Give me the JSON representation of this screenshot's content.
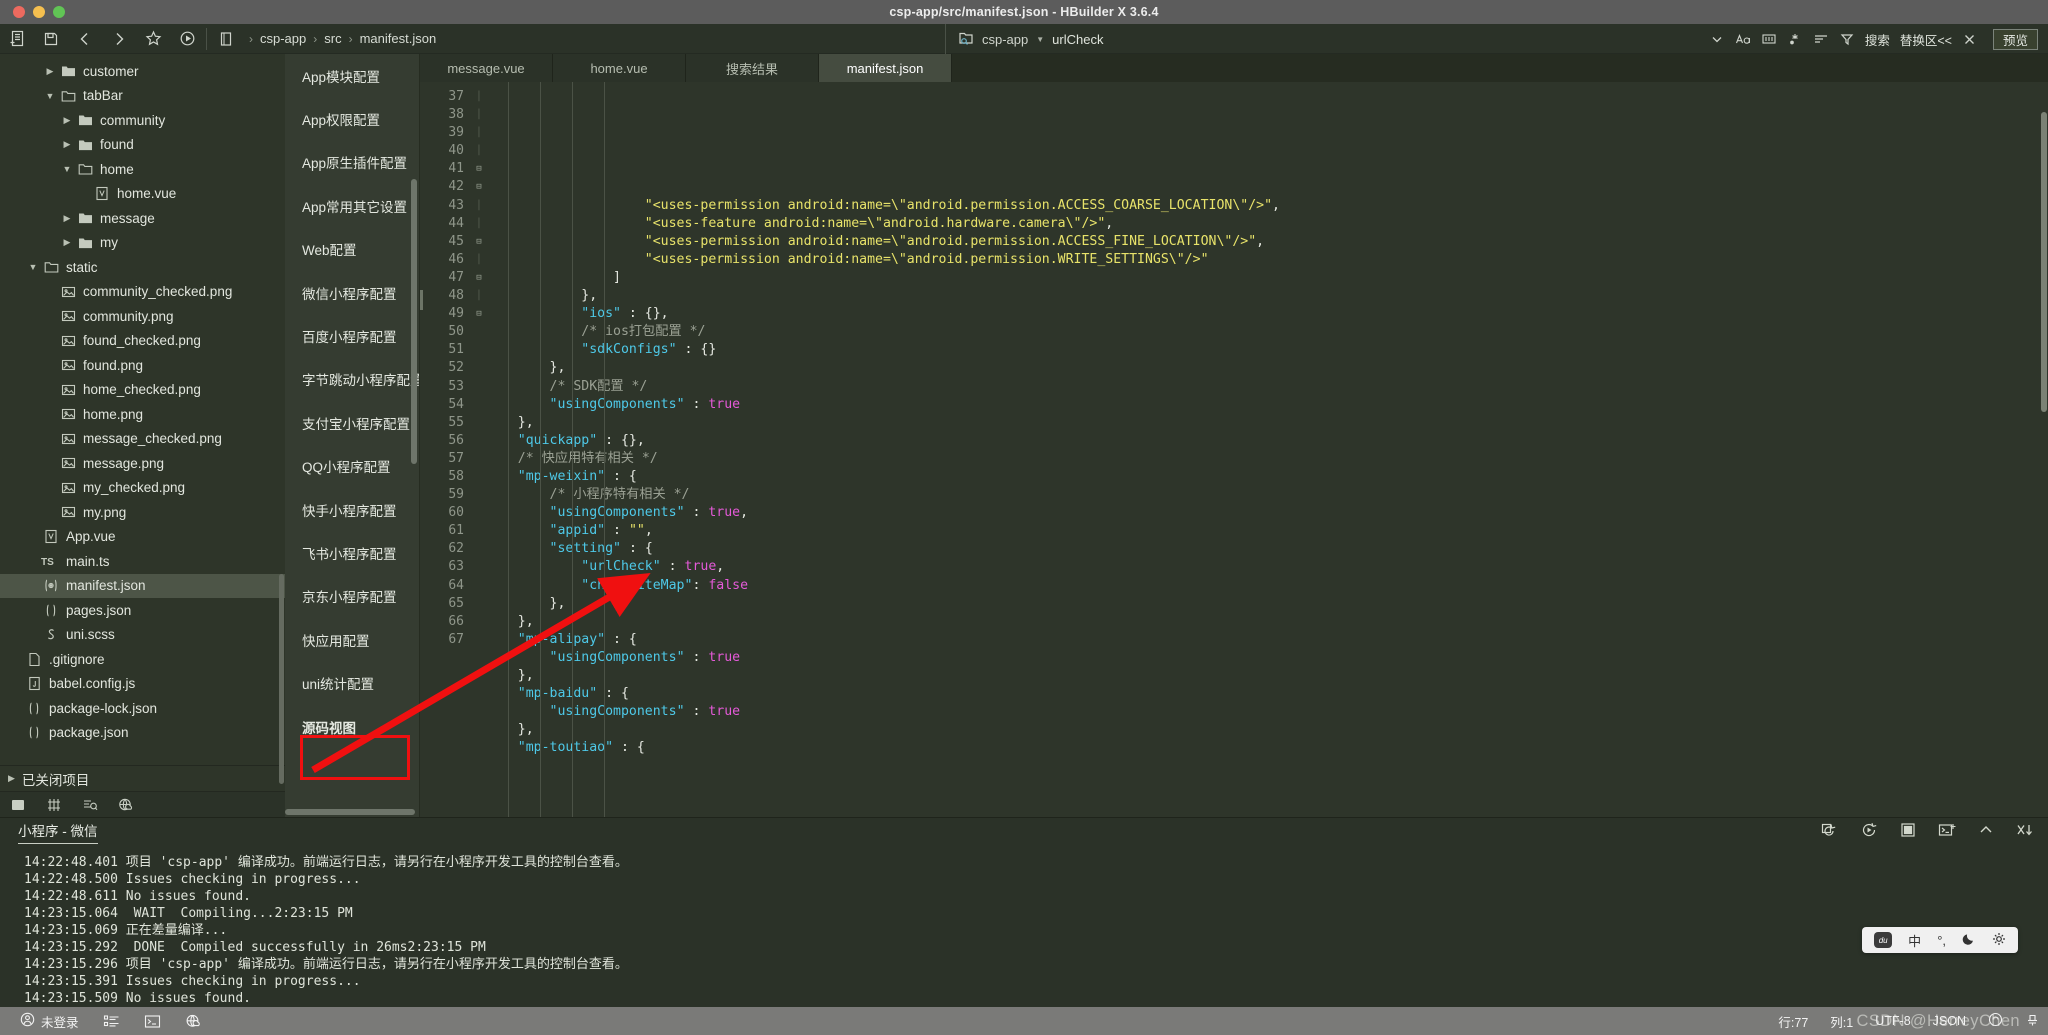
{
  "window": {
    "title": "csp-app/src/manifest.json - HBuilder X 3.6.4"
  },
  "toolbar": {
    "breadcrumb": [
      "csp-app",
      "src",
      "manifest.json"
    ],
    "project_chip": "csp-app",
    "symbol": "urlCheck",
    "search_label": "搜索",
    "replace_label": "替换区<<",
    "preview_label": "预览"
  },
  "filetree": {
    "items": [
      {
        "label": "customer",
        "depth": 2,
        "arrow": "collapsed",
        "icon": "folder-icon",
        "selected": false
      },
      {
        "label": "tabBar",
        "depth": 2,
        "arrow": "expanded",
        "icon": "folder-open-icon",
        "selected": false
      },
      {
        "label": "community",
        "depth": 3,
        "arrow": "collapsed",
        "icon": "folder-icon",
        "selected": false
      },
      {
        "label": "found",
        "depth": 3,
        "arrow": "collapsed",
        "icon": "folder-icon",
        "selected": false
      },
      {
        "label": "home",
        "depth": 3,
        "arrow": "expanded",
        "icon": "folder-open-icon",
        "selected": false
      },
      {
        "label": "home.vue",
        "depth": 4,
        "arrow": "none",
        "icon": "vue-file-icon",
        "selected": false
      },
      {
        "label": "message",
        "depth": 3,
        "arrow": "collapsed",
        "icon": "folder-icon",
        "selected": false
      },
      {
        "label": "my",
        "depth": 3,
        "arrow": "collapsed",
        "icon": "folder-icon",
        "selected": false
      },
      {
        "label": "static",
        "depth": 1,
        "arrow": "expanded",
        "icon": "folder-open-icon",
        "selected": false
      },
      {
        "label": "community_checked.png",
        "depth": 2,
        "arrow": "none",
        "icon": "image-file-icon",
        "selected": false
      },
      {
        "label": "community.png",
        "depth": 2,
        "arrow": "none",
        "icon": "image-file-icon",
        "selected": false
      },
      {
        "label": "found_checked.png",
        "depth": 2,
        "arrow": "none",
        "icon": "image-file-icon",
        "selected": false
      },
      {
        "label": "found.png",
        "depth": 2,
        "arrow": "none",
        "icon": "image-file-icon",
        "selected": false
      },
      {
        "label": "home_checked.png",
        "depth": 2,
        "arrow": "none",
        "icon": "image-file-icon",
        "selected": false
      },
      {
        "label": "home.png",
        "depth": 2,
        "arrow": "none",
        "icon": "image-file-icon",
        "selected": false
      },
      {
        "label": "message_checked.png",
        "depth": 2,
        "arrow": "none",
        "icon": "image-file-icon",
        "selected": false
      },
      {
        "label": "message.png",
        "depth": 2,
        "arrow": "none",
        "icon": "image-file-icon",
        "selected": false
      },
      {
        "label": "my_checked.png",
        "depth": 2,
        "arrow": "none",
        "icon": "image-file-icon",
        "selected": false
      },
      {
        "label": "my.png",
        "depth": 2,
        "arrow": "none",
        "icon": "image-file-icon",
        "selected": false
      },
      {
        "label": "App.vue",
        "depth": 1,
        "arrow": "none",
        "icon": "vue-file-icon",
        "selected": false
      },
      {
        "label": "main.ts",
        "depth": 1,
        "arrow": "none",
        "icon": "ts-file-icon",
        "selected": false
      },
      {
        "label": "manifest.json",
        "depth": 1,
        "arrow": "none",
        "icon": "manifest-file-icon",
        "selected": true
      },
      {
        "label": "pages.json",
        "depth": 1,
        "arrow": "none",
        "icon": "json-file-icon",
        "selected": false
      },
      {
        "label": "uni.scss",
        "depth": 1,
        "arrow": "none",
        "icon": "scss-file-icon",
        "selected": false
      },
      {
        "label": ".gitignore",
        "depth": 0,
        "arrow": "none",
        "icon": "text-file-icon",
        "selected": false
      },
      {
        "label": "babel.config.js",
        "depth": 0,
        "arrow": "none",
        "icon": "js-file-icon",
        "selected": false
      },
      {
        "label": "package-lock.json",
        "depth": 0,
        "arrow": "none",
        "icon": "json-file-icon",
        "selected": false
      },
      {
        "label": "package.json",
        "depth": 0,
        "arrow": "none",
        "icon": "json-file-icon",
        "selected": false
      }
    ],
    "closed_projects": "已关闭项目"
  },
  "manifest_nav": {
    "items": [
      "App模块配置",
      "App权限配置",
      "App原生插件配置",
      "App常用其它设置",
      "Web配置",
      "微信小程序配置",
      "百度小程序配置",
      "字节跳动小程序配置",
      "支付宝小程序配置",
      "QQ小程序配置",
      "快手小程序配置",
      "飞书小程序配置",
      "京东小程序配置",
      "快应用配置",
      "uni统计配置",
      "源码视图"
    ],
    "highlighted": "源码视图"
  },
  "editor": {
    "tabs": [
      {
        "label": "message.vue",
        "active": false
      },
      {
        "label": "home.vue",
        "active": false
      },
      {
        "label": "搜索结果",
        "active": false
      },
      {
        "label": "manifest.json",
        "active": true
      }
    ],
    "first_line": 37,
    "lines": [
      {
        "n": 37,
        "fold": "",
        "indent": 5,
        "tokens": [
          {
            "t": "\"<uses-permission android:name=\\\"android.permission.ACCESS_COARSE_LOCATION\\\"/>\"",
            "c": "k-str"
          },
          {
            "t": ",",
            "c": "k-pun"
          }
        ]
      },
      {
        "n": 38,
        "fold": "",
        "indent": 5,
        "tokens": [
          {
            "t": "\"<uses-feature android:name=\\\"android.hardware.camera\\\"/>\"",
            "c": "k-str"
          },
          {
            "t": ",",
            "c": "k-pun"
          }
        ]
      },
      {
        "n": 39,
        "fold": "",
        "indent": 5,
        "tokens": [
          {
            "t": "\"<uses-permission android:name=\\\"android.permission.ACCESS_FINE_LOCATION\\\"/>\"",
            "c": "k-str"
          },
          {
            "t": ",",
            "c": "k-pun"
          }
        ]
      },
      {
        "n": 40,
        "fold": "",
        "indent": 5,
        "tokens": [
          {
            "t": "\"<uses-permission android:name=\\\"android.permission.WRITE_SETTINGS\\\"/>\"",
            "c": "k-str"
          }
        ]
      },
      {
        "n": 41,
        "fold": "-",
        "indent": 4,
        "tokens": [
          {
            "t": "]",
            "c": "k-pun"
          }
        ]
      },
      {
        "n": 42,
        "fold": "-",
        "indent": 3,
        "tokens": [
          {
            "t": "},",
            "c": "k-pun"
          }
        ]
      },
      {
        "n": 43,
        "fold": "",
        "indent": 3,
        "tokens": [
          {
            "t": "\"ios\"",
            "c": "k-key"
          },
          {
            "t": " : {},",
            "c": "k-pun"
          }
        ]
      },
      {
        "n": 44,
        "fold": "",
        "indent": 3,
        "tokens": [
          {
            "t": "/* ios打包配置 */",
            "c": "k-com"
          }
        ]
      },
      {
        "n": 45,
        "fold": "",
        "indent": 3,
        "tokens": [
          {
            "t": "\"sdkConfigs\"",
            "c": "k-key"
          },
          {
            "t": " : {}",
            "c": "k-pun"
          }
        ]
      },
      {
        "n": 46,
        "fold": "-",
        "indent": 2,
        "tokens": [
          {
            "t": "},",
            "c": "k-pun"
          }
        ]
      },
      {
        "n": 47,
        "fold": "",
        "indent": 2,
        "tokens": [
          {
            "t": "/* SDK配置 */",
            "c": "k-com"
          }
        ]
      },
      {
        "n": 48,
        "fold": "",
        "indent": 2,
        "tokens": [
          {
            "t": "\"usingComponents\"",
            "c": "k-key"
          },
          {
            "t": " : ",
            "c": "k-pun"
          },
          {
            "t": "true",
            "c": "k-val"
          }
        ]
      },
      {
        "n": 49,
        "fold": "-",
        "indent": 1,
        "tokens": [
          {
            "t": "},",
            "c": "k-pun"
          }
        ]
      },
      {
        "n": 50,
        "fold": "",
        "indent": 1,
        "tokens": [
          {
            "t": "\"quickapp\"",
            "c": "k-key"
          },
          {
            "t": " : {},",
            "c": "k-pun"
          }
        ]
      },
      {
        "n": 51,
        "fold": "",
        "indent": 1,
        "tokens": [
          {
            "t": "/* 快应用特有相关 */",
            "c": "k-com"
          }
        ]
      },
      {
        "n": 52,
        "fold": "+",
        "indent": 1,
        "tokens": [
          {
            "t": "\"mp-weixin\"",
            "c": "k-key"
          },
          {
            "t": " : {",
            "c": "k-pun"
          }
        ]
      },
      {
        "n": 53,
        "fold": "",
        "indent": 2,
        "tokens": [
          {
            "t": "/* 小程序特有相关 */",
            "c": "k-com"
          }
        ]
      },
      {
        "n": 54,
        "fold": "",
        "indent": 2,
        "tokens": [
          {
            "t": "\"usingComponents\"",
            "c": "k-key"
          },
          {
            "t": " : ",
            "c": "k-pun"
          },
          {
            "t": "true",
            "c": "k-val"
          },
          {
            "t": ",",
            "c": "k-pun"
          }
        ]
      },
      {
        "n": 55,
        "fold": "",
        "indent": 2,
        "tokens": [
          {
            "t": "\"appid\"",
            "c": "k-key"
          },
          {
            "t": " : ",
            "c": "k-pun"
          },
          {
            "t": "\"\"",
            "c": "k-str"
          },
          {
            "t": ",",
            "c": "k-pun"
          }
        ]
      },
      {
        "n": 56,
        "fold": "+",
        "indent": 2,
        "tokens": [
          {
            "t": "\"setting\"",
            "c": "k-key"
          },
          {
            "t": " : {",
            "c": "k-pun"
          }
        ]
      },
      {
        "n": 57,
        "fold": "",
        "indent": 3,
        "tokens": [
          {
            "t": "\"urlCheck\"",
            "c": "k-key"
          },
          {
            "t": " : ",
            "c": "k-pun"
          },
          {
            "t": "true",
            "c": "k-val"
          },
          {
            "t": ",",
            "c": "k-pun"
          }
        ]
      },
      {
        "n": 58,
        "fold": "",
        "indent": 3,
        "tokens": [
          {
            "t": "\"checkSiteMap\"",
            "c": "k-key"
          },
          {
            "t": ": ",
            "c": "k-pun"
          },
          {
            "t": "false",
            "c": "k-val"
          }
        ]
      },
      {
        "n": 59,
        "fold": "-",
        "indent": 2,
        "tokens": [
          {
            "t": "},",
            "c": "k-pun"
          }
        ]
      },
      {
        "n": 60,
        "fold": "-",
        "indent": 1,
        "tokens": [
          {
            "t": "},",
            "c": "k-pun"
          }
        ]
      },
      {
        "n": 61,
        "fold": "+",
        "indent": 1,
        "tokens": [
          {
            "t": "\"mp-alipay\"",
            "c": "k-key"
          },
          {
            "t": " : {",
            "c": "k-pun"
          }
        ]
      },
      {
        "n": 62,
        "fold": "",
        "indent": 2,
        "tokens": [
          {
            "t": "\"usingComponents\"",
            "c": "k-key"
          },
          {
            "t": " : ",
            "c": "k-pun"
          },
          {
            "t": "true",
            "c": "k-val"
          }
        ]
      },
      {
        "n": 63,
        "fold": "-",
        "indent": 1,
        "tokens": [
          {
            "t": "},",
            "c": "k-pun"
          }
        ]
      },
      {
        "n": 64,
        "fold": "+",
        "indent": 1,
        "tokens": [
          {
            "t": "\"mp-baidu\"",
            "c": "k-key"
          },
          {
            "t": " : {",
            "c": "k-pun"
          }
        ]
      },
      {
        "n": 65,
        "fold": "",
        "indent": 2,
        "tokens": [
          {
            "t": "\"usingComponents\"",
            "c": "k-key"
          },
          {
            "t": " : ",
            "c": "k-pun"
          },
          {
            "t": "true",
            "c": "k-val"
          }
        ]
      },
      {
        "n": 66,
        "fold": "-",
        "indent": 1,
        "tokens": [
          {
            "t": "},",
            "c": "k-pun"
          }
        ]
      },
      {
        "n": 67,
        "fold": "+",
        "indent": 1,
        "tokens": [
          {
            "t": "\"mp-toutiao\"",
            "c": "k-key"
          },
          {
            "t": " : {",
            "c": "k-pun"
          }
        ]
      }
    ]
  },
  "console": {
    "title": "小程序 - 微信",
    "logs": [
      "14:22:48.401 项目 'csp-app' 编译成功。前端运行日志，请另行在小程序开发工具的控制台查看。",
      "14:22:48.500 Issues checking in progress...",
      "14:22:48.611 No issues found.",
      "14:23:15.064  WAIT  Compiling...2:23:15 PM",
      "14:23:15.069 正在差量编译...",
      "14:23:15.292  DONE  Compiled successfully in 26ms2:23:15 PM",
      "14:23:15.296 项目 'csp-app' 编译成功。前端运行日志，请另行在小程序开发工具的控制台查看。",
      "14:23:15.391 Issues checking in progress...",
      "14:23:15.509 No issues found."
    ]
  },
  "statusbar": {
    "account": "未登录",
    "row": "行:77",
    "col": "列:1",
    "encoding": "UTF-8",
    "language": "JSON",
    "watermark": "CSDN @HerreyChen"
  },
  "ime": {
    "brand": "du",
    "mode": "中",
    "punct": "°,"
  },
  "colors": {
    "accent_red": "#f01010",
    "editor_bg": "#2e352a",
    "panel_bg": "#2b3228"
  }
}
